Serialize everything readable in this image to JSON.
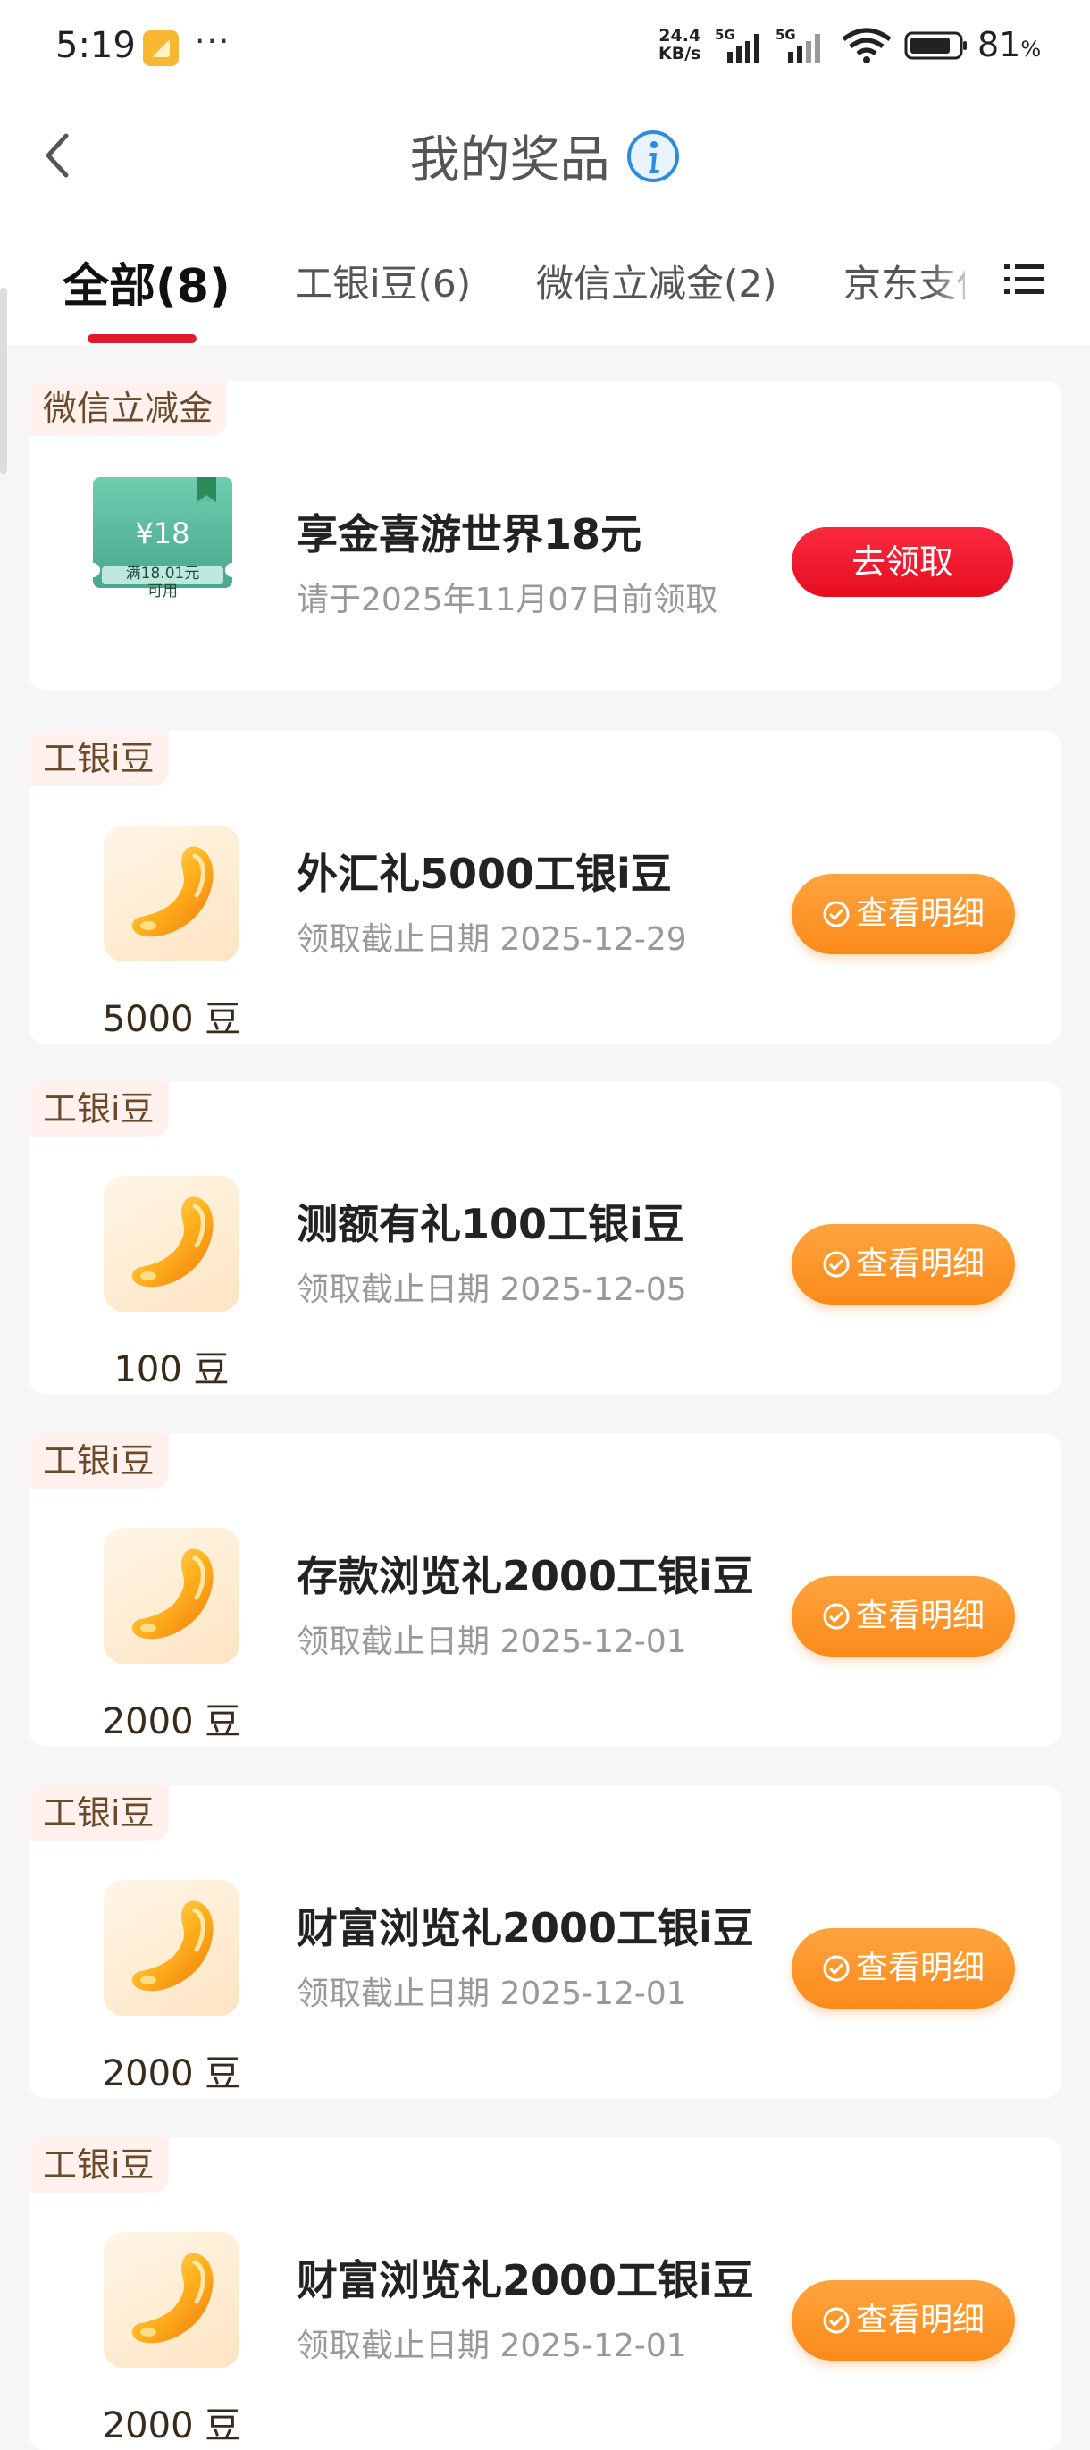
{
  "status_bar": {
    "time": "5:19",
    "network_speed": "24.4",
    "network_speed_unit": "KB/s",
    "sim1_type": "5G",
    "sim2_type": "5G",
    "battery_percent": "81",
    "battery_unit": "%"
  },
  "header": {
    "title": "我的奖品"
  },
  "tabs": [
    {
      "label": "全部(8)",
      "active": true
    },
    {
      "label": "工银i豆(6)",
      "active": false
    },
    {
      "label": "微信立减金(2)",
      "active": false
    },
    {
      "label": "京东支付",
      "active": false
    }
  ],
  "colors": {
    "accent_red": "#e11b2b",
    "button_orange": "#fb8a1a",
    "voucher_green": "#5bbfa3"
  },
  "prizes": [
    {
      "tag": "微信立减金",
      "name": "享金喜游世界18元",
      "date": "请于2025年11月07日前领取",
      "button": "去领取",
      "voucher_price": "¥18",
      "voucher_note1": "满18.01元",
      "voucher_note2": "可用"
    },
    {
      "tag": "工银i豆",
      "name": "外汇礼5000工银i豆",
      "date": "领取截止日期 2025-12-29",
      "button": "查看明细",
      "amount": "5000 豆"
    },
    {
      "tag": "工银i豆",
      "name": "测额有礼100工银i豆",
      "date": "领取截止日期 2025-12-05",
      "button": "查看明细",
      "amount": "100 豆"
    },
    {
      "tag": "工银i豆",
      "name": "存款浏览礼2000工银i豆",
      "date": "领取截止日期 2025-12-01",
      "button": "查看明细",
      "amount": "2000 豆"
    },
    {
      "tag": "工银i豆",
      "name": "财富浏览礼2000工银i豆",
      "date": "领取截止日期 2025-12-01",
      "button": "查看明细",
      "amount": "2000 豆"
    },
    {
      "tag": "工银i豆",
      "name": "财富浏览礼2000工银i豆",
      "date": "领取截止日期 2025-12-01",
      "button": "查看明细",
      "amount": "2000 豆"
    }
  ]
}
